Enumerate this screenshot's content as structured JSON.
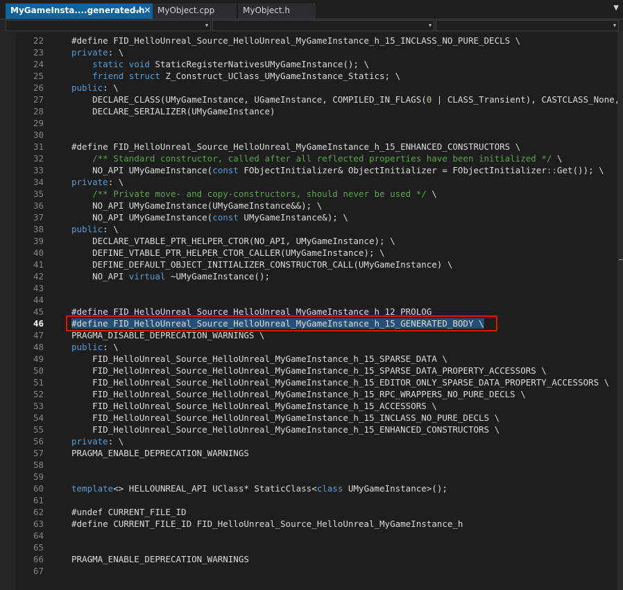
{
  "tabs": [
    {
      "label": "MyGameInsta....generated.h",
      "active": true,
      "pin_icon": "⊸",
      "close_icon": "✕"
    },
    {
      "label": "MyObject.cpp",
      "active": false
    },
    {
      "label": "MyObject.h",
      "active": false
    }
  ],
  "tab_overflow_icon": "▼",
  "nav_dropdown_icon": "▾",
  "current_line": 46,
  "colors": {
    "accent": "#0e639c",
    "selection": "#264f78",
    "highlight_border": "#e51400",
    "keyword": "#569cd6",
    "comment": "#57a64a"
  },
  "lines": [
    {
      "n": "22",
      "tokens": [
        {
          "t": "#define FID_HelloUnreal_Source_HelloUnreal_MyGameInstance_h_15_INCLASS_NO_PURE_DECLS \\",
          "c": ""
        }
      ]
    },
    {
      "n": "23",
      "tokens": [
        {
          "t": "private",
          "c": "kw"
        },
        {
          "t": ": \\",
          "c": ""
        }
      ]
    },
    {
      "n": "24",
      "tokens": [
        {
          "t": "    ",
          "c": ""
        },
        {
          "t": "static",
          "c": "kw"
        },
        {
          "t": " ",
          "c": ""
        },
        {
          "t": "void",
          "c": "kw"
        },
        {
          "t": " StaticRegisterNativesUMyGameInstance(); \\",
          "c": ""
        }
      ]
    },
    {
      "n": "25",
      "tokens": [
        {
          "t": "    ",
          "c": ""
        },
        {
          "t": "friend",
          "c": "kw"
        },
        {
          "t": " ",
          "c": ""
        },
        {
          "t": "struct",
          "c": "kw"
        },
        {
          "t": " Z_Construct_UClass_UMyGameInstance_Statics; \\",
          "c": ""
        }
      ]
    },
    {
      "n": "26",
      "tokens": [
        {
          "t": "public",
          "c": "kw"
        },
        {
          "t": ": \\",
          "c": ""
        }
      ]
    },
    {
      "n": "27",
      "tokens": [
        {
          "t": "    DECLARE_CLASS(UMyGameInstance, UGameInstance, COMPILED_IN_FLAGS(",
          "c": ""
        },
        {
          "t": "0",
          "c": "num"
        },
        {
          "t": " | CLASS_Transient), CASTCLASS_None, TEXT(",
          "c": ""
        }
      ]
    },
    {
      "n": "28",
      "tokens": [
        {
          "t": "    DECLARE_SERIALIZER(UMyGameInstance)",
          "c": ""
        }
      ]
    },
    {
      "n": "29",
      "tokens": []
    },
    {
      "n": "30",
      "tokens": []
    },
    {
      "n": "31",
      "tokens": [
        {
          "t": "#define FID_HelloUnreal_Source_HelloUnreal_MyGameInstance_h_15_ENHANCED_CONSTRUCTORS \\",
          "c": ""
        }
      ]
    },
    {
      "n": "32",
      "tokens": [
        {
          "t": "    ",
          "c": ""
        },
        {
          "t": "/** Standard constructor, called after all reflected properties have been initialized */",
          "c": "cm"
        },
        {
          "t": " \\",
          "c": ""
        }
      ]
    },
    {
      "n": "33",
      "tokens": [
        {
          "t": "    NO_API UMyGameInstance(",
          "c": ""
        },
        {
          "t": "const",
          "c": "kw"
        },
        {
          "t": " FObjectInitializer& ObjectInitializer = FObjectInitializer",
          "c": ""
        },
        {
          "t": "::",
          "c": "op"
        },
        {
          "t": "Get()); \\",
          "c": ""
        }
      ]
    },
    {
      "n": "34",
      "tokens": [
        {
          "t": "private",
          "c": "kw"
        },
        {
          "t": ": \\",
          "c": ""
        }
      ]
    },
    {
      "n": "35",
      "tokens": [
        {
          "t": "    ",
          "c": ""
        },
        {
          "t": "/** Private move- and copy-constructors, should never be used */",
          "c": "cm"
        },
        {
          "t": " \\",
          "c": ""
        }
      ]
    },
    {
      "n": "36",
      "tokens": [
        {
          "t": "    NO_API UMyGameInstance(UMyGameInstance&&); \\",
          "c": ""
        }
      ]
    },
    {
      "n": "37",
      "tokens": [
        {
          "t": "    NO_API UMyGameInstance(",
          "c": ""
        },
        {
          "t": "const",
          "c": "kw"
        },
        {
          "t": " UMyGameInstance&); \\",
          "c": ""
        }
      ]
    },
    {
      "n": "38",
      "tokens": [
        {
          "t": "public",
          "c": "kw"
        },
        {
          "t": ": \\",
          "c": ""
        }
      ]
    },
    {
      "n": "39",
      "tokens": [
        {
          "t": "    DECLARE_VTABLE_PTR_HELPER_CTOR(NO_API, UMyGameInstance); \\",
          "c": ""
        }
      ]
    },
    {
      "n": "40",
      "tokens": [
        {
          "t": "    DEFINE_VTABLE_PTR_HELPER_CTOR_CALLER(UMyGameInstance); \\",
          "c": ""
        }
      ]
    },
    {
      "n": "41",
      "tokens": [
        {
          "t": "    DEFINE_DEFAULT_OBJECT_INITIALIZER_CONSTRUCTOR_CALL(UMyGameInstance) \\",
          "c": ""
        }
      ]
    },
    {
      "n": "42",
      "tokens": [
        {
          "t": "    NO_API ",
          "c": ""
        },
        {
          "t": "virtual",
          "c": "kw"
        },
        {
          "t": " ~UMyGameInstance();",
          "c": ""
        }
      ]
    },
    {
      "n": "43",
      "tokens": []
    },
    {
      "n": "44",
      "tokens": []
    },
    {
      "n": "45",
      "tokens": [
        {
          "t": "#define FID_HelloUnreal_Source_HelloUnreal_MyGameInstance_h_12_PROLOG",
          "c": ""
        }
      ]
    },
    {
      "n": "46",
      "selected": true,
      "tokens": [
        {
          "t": "#define FID_HelloUnreal_Source_HelloUnreal_MyGameInstance_h_15_GENERATED_BODY \\",
          "c": "sel"
        }
      ]
    },
    {
      "n": "47",
      "tokens": [
        {
          "t": "PRAGMA_DISABLE_DEPRECATION_WARNINGS \\",
          "c": ""
        }
      ]
    },
    {
      "n": "48",
      "tokens": [
        {
          "t": "public",
          "c": "kw"
        },
        {
          "t": ": \\",
          "c": ""
        }
      ]
    },
    {
      "n": "49",
      "tokens": [
        {
          "t": "    FID_HelloUnreal_Source_HelloUnreal_MyGameInstance_h_15_SPARSE_DATA \\",
          "c": ""
        }
      ]
    },
    {
      "n": "50",
      "tokens": [
        {
          "t": "    FID_HelloUnreal_Source_HelloUnreal_MyGameInstance_h_15_SPARSE_DATA_PROPERTY_ACCESSORS \\",
          "c": ""
        }
      ]
    },
    {
      "n": "51",
      "tokens": [
        {
          "t": "    FID_HelloUnreal_Source_HelloUnreal_MyGameInstance_h_15_EDITOR_ONLY_SPARSE_DATA_PROPERTY_ACCESSORS \\",
          "c": ""
        }
      ]
    },
    {
      "n": "52",
      "tokens": [
        {
          "t": "    FID_HelloUnreal_Source_HelloUnreal_MyGameInstance_h_15_RPC_WRAPPERS_NO_PURE_DECLS \\",
          "c": ""
        }
      ]
    },
    {
      "n": "53",
      "tokens": [
        {
          "t": "    FID_HelloUnreal_Source_HelloUnreal_MyGameInstance_h_15_ACCESSORS \\",
          "c": ""
        }
      ]
    },
    {
      "n": "54",
      "tokens": [
        {
          "t": "    FID_HelloUnreal_Source_HelloUnreal_MyGameInstance_h_15_INCLASS_NO_PURE_DECLS \\",
          "c": ""
        }
      ]
    },
    {
      "n": "55",
      "tokens": [
        {
          "t": "    FID_HelloUnreal_Source_HelloUnreal_MyGameInstance_h_15_ENHANCED_CONSTRUCTORS \\",
          "c": ""
        }
      ]
    },
    {
      "n": "56",
      "tokens": [
        {
          "t": "private",
          "c": "kw"
        },
        {
          "t": ": \\",
          "c": ""
        }
      ]
    },
    {
      "n": "57",
      "tokens": [
        {
          "t": "PRAGMA_ENABLE_DEPRECATION_WARNINGS",
          "c": ""
        }
      ]
    },
    {
      "n": "58",
      "tokens": []
    },
    {
      "n": "59",
      "tokens": []
    },
    {
      "n": "60",
      "tokens": [
        {
          "t": "template",
          "c": "kw"
        },
        {
          "t": "<> HELLOUNREAL_API UClass* StaticClass<",
          "c": ""
        },
        {
          "t": "class",
          "c": "kw"
        },
        {
          "t": " UMyGameInstance>();",
          "c": ""
        }
      ]
    },
    {
      "n": "61",
      "tokens": []
    },
    {
      "n": "62",
      "tokens": [
        {
          "t": "#undef CURRENT_FILE_ID",
          "c": ""
        }
      ]
    },
    {
      "n": "63",
      "tokens": [
        {
          "t": "#define CURRENT_FILE_ID FID_HelloUnreal_Source_HelloUnreal_MyGameInstance_h",
          "c": ""
        }
      ]
    },
    {
      "n": "64",
      "tokens": []
    },
    {
      "n": "65",
      "tokens": []
    },
    {
      "n": "66",
      "tokens": [
        {
          "t": "PRAGMA_ENABLE_DEPRECATION_WARNINGS",
          "c": ""
        }
      ]
    },
    {
      "n": "67",
      "tokens": []
    }
  ]
}
